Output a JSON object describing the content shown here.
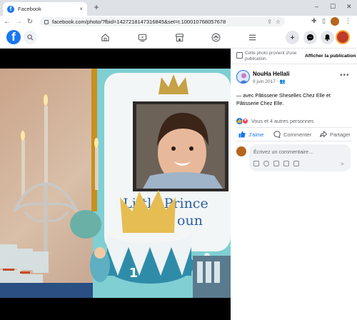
{
  "browser": {
    "tab_title": "Facebook",
    "tab_favicon": "f",
    "tab_close": "×",
    "new_tab": "+",
    "url": "facebook.com/photo/?fbid=1427218147316845&set=t.100010768057678",
    "window_controls": {
      "minimize": "–",
      "maximize": "☐",
      "close": "✕"
    },
    "nav": {
      "back": "←",
      "forward": "→",
      "reload": "↻"
    }
  },
  "fb_nav": {
    "logo": "f",
    "icons": [
      "search-icon",
      "home-icon",
      "watch-icon",
      "marketplace-icon",
      "groups-icon",
      "menu-icon",
      "create-icon",
      "messenger-icon",
      "notifications-icon"
    ]
  },
  "viewer": {
    "tools": [
      "zoom-in-icon",
      "zoom-out-icon",
      "tag-icon",
      "fullscreen-icon"
    ],
    "photo_text": {
      "line1": "Little Prince",
      "line2": "oun",
      "cake_number": "1"
    }
  },
  "side": {
    "notice": "Cette photo provient d'une publication.",
    "notice_link": "Afficher la publication",
    "author": "NouHa Hellali",
    "date": "9 juin 2017 ·",
    "caption_prefix": "— avec ",
    "tag1": "Pâtisserie Sheselles Chez Elle",
    "caption_mid": " et ",
    "tag2": "Pâtisserie Chez Elle.",
    "reactions_text": "Vous et 4 autres personnes",
    "actions": {
      "like": "J'aime",
      "comment": "Commenter",
      "share": "Partager"
    },
    "comment_placeholder": "Écrivez un commentaire…"
  },
  "colors": {
    "fb_blue": "#1877f2",
    "text_secondary": "#65676b",
    "love_red": "#f33e58"
  }
}
